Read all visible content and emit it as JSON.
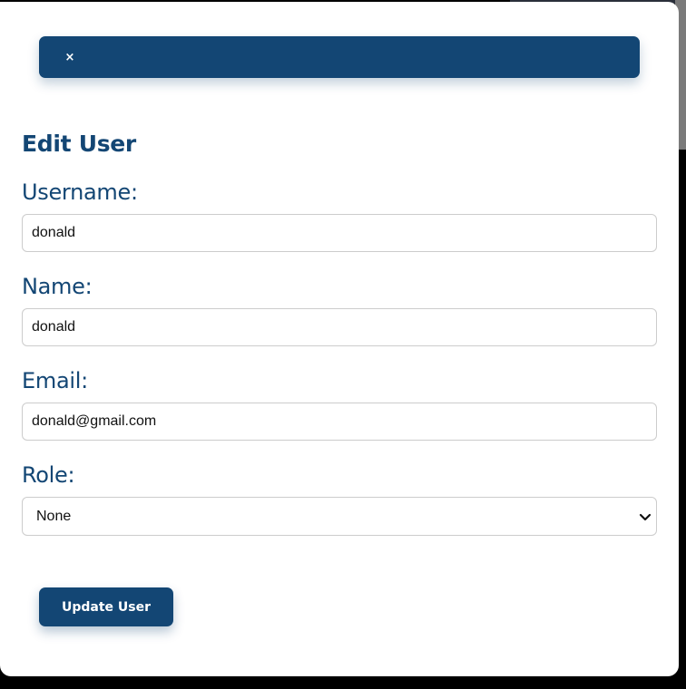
{
  "header": {
    "close_label": "×"
  },
  "form": {
    "title": "Edit User",
    "username": {
      "label": "Username:",
      "value": "donald"
    },
    "name": {
      "label": "Name:",
      "value": "donald"
    },
    "email": {
      "label": "Email:",
      "value": "donald@gmail.com"
    },
    "role": {
      "label": "Role:",
      "value": "None"
    },
    "submit_label": "Update User"
  },
  "colors": {
    "primary": "#134674",
    "input_border": "#cccccc",
    "background": "#ffffff"
  },
  "icons": {
    "close": "close-icon",
    "select": "chevron-down-icon"
  }
}
